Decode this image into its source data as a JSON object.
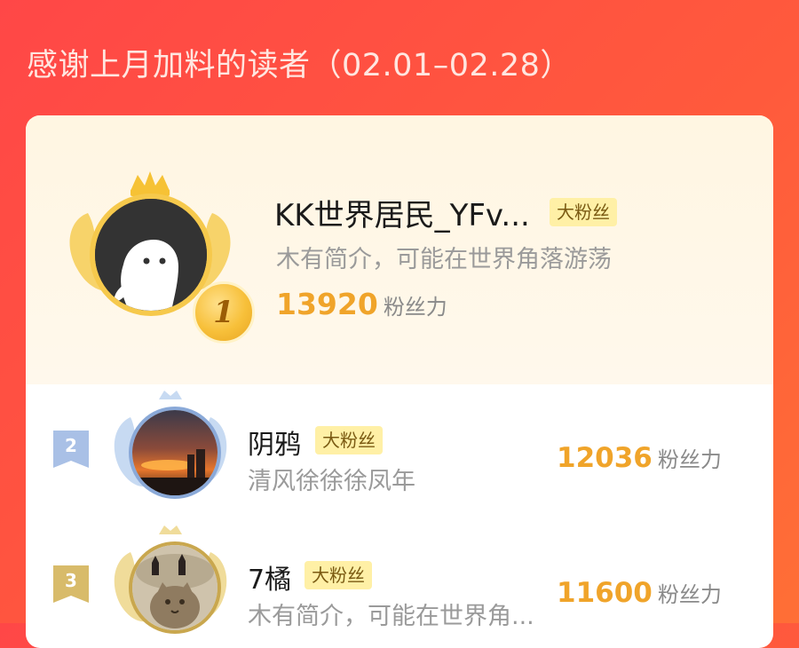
{
  "header": {
    "title": "感谢上月加料的读者（02.01–02.28）"
  },
  "fan_label": "大粉丝",
  "score_unit": "粉丝力",
  "readers": [
    {
      "rank": "1",
      "name": "KK世界居民_YFv...",
      "bio": "木有简介，可能在世界角落游荡",
      "score": "13920"
    },
    {
      "rank": "2",
      "name": "阴鸦",
      "bio": "清风徐徐徐凤年",
      "score": "12036"
    },
    {
      "rank": "3",
      "name": "7橘",
      "bio": "木有简介，可能在世界角...",
      "score": "11600"
    }
  ],
  "colors": {
    "background": "#ff4a45",
    "score": "#f0a42a",
    "fan_tag_bg": "#fff0a6",
    "top_card_bg": "#fff6e2",
    "rank2_ribbon": "#a9c0e6",
    "rank3_ribbon": "#d8bb6a"
  }
}
